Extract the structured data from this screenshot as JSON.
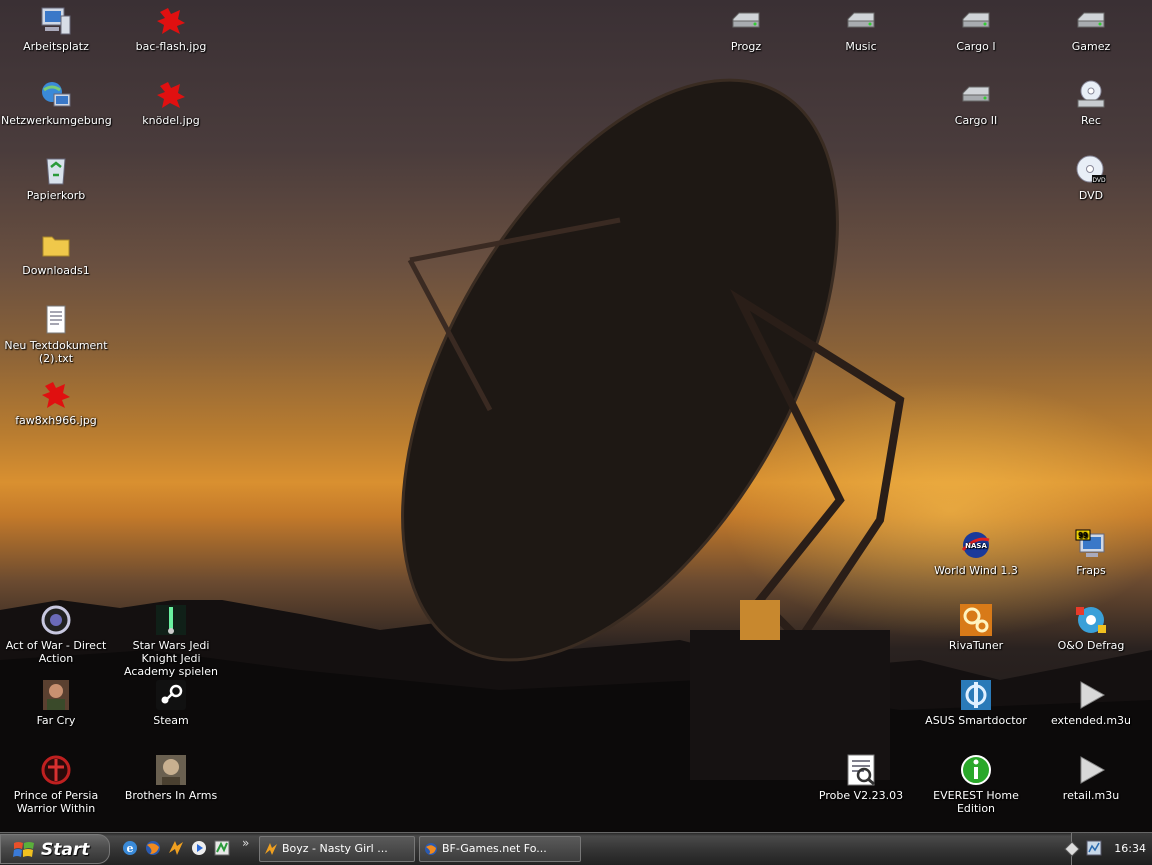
{
  "desktop_icons": [
    {
      "label": "Arbeitsplatz",
      "icon": "my-computer-icon"
    },
    {
      "label": "bac-flash.jpg",
      "icon": "jpg-file-icon"
    },
    {
      "label": "Netzwerkumgebung",
      "icon": "network-icon"
    },
    {
      "label": "knödel.jpg",
      "icon": "jpg-file-icon"
    },
    {
      "label": "Papierkorb",
      "icon": "recycle-bin-icon"
    },
    {
      "label": "Downloads1",
      "icon": "folder-icon"
    },
    {
      "label": "Neu Textdokument (2).txt",
      "icon": "text-file-icon"
    },
    {
      "label": "faw8xh966.jpg",
      "icon": "jpg-file-icon"
    },
    {
      "label": "Progz",
      "icon": "drive-icon"
    },
    {
      "label": "Music",
      "icon": "drive-icon"
    },
    {
      "label": "Cargo I",
      "icon": "drive-icon"
    },
    {
      "label": "Gamez",
      "icon": "drive-icon"
    },
    {
      "label": "Cargo II",
      "icon": "drive-icon"
    },
    {
      "label": "Rec",
      "icon": "cd-drive-icon"
    },
    {
      "label": "DVD",
      "icon": "dvd-drive-icon"
    },
    {
      "label": "World Wind 1.3",
      "icon": "nasa-icon"
    },
    {
      "label": "Fraps",
      "icon": "fraps-icon"
    },
    {
      "label": "Act of War - Direct Action",
      "icon": "game-icon"
    },
    {
      "label": "Star Wars Jedi Knight Jedi Academy spielen",
      "icon": "game-icon"
    },
    {
      "label": "RivaTuner",
      "icon": "gears-icon"
    },
    {
      "label": "O&O Defrag",
      "icon": "defrag-icon"
    },
    {
      "label": "Far Cry",
      "icon": "game-icon"
    },
    {
      "label": "Steam",
      "icon": "steam-icon"
    },
    {
      "label": "ASUS Smartdoctor",
      "icon": "asus-icon"
    },
    {
      "label": "extended.m3u",
      "icon": "playlist-icon"
    },
    {
      "label": "Prince of Persia Warrior Within",
      "icon": "game-icon"
    },
    {
      "label": "Brothers In Arms",
      "icon": "game-icon"
    },
    {
      "label": "Probe V2.23.03",
      "icon": "probe-icon"
    },
    {
      "label": "EVEREST Home Edition",
      "icon": "info-icon"
    },
    {
      "label": "retail.m3u",
      "icon": "playlist-icon"
    }
  ],
  "taskbar": {
    "start_label": "Start",
    "more_label": "»",
    "tasks": [
      {
        "label": "Boyz - Nasty Girl ...",
        "icon": "winamp-icon"
      },
      {
        "label": "BF-Games.net Fo...",
        "icon": "firefox-icon"
      }
    ],
    "clock": "16:34"
  },
  "colors": {
    "accent": "#e08a2a"
  }
}
